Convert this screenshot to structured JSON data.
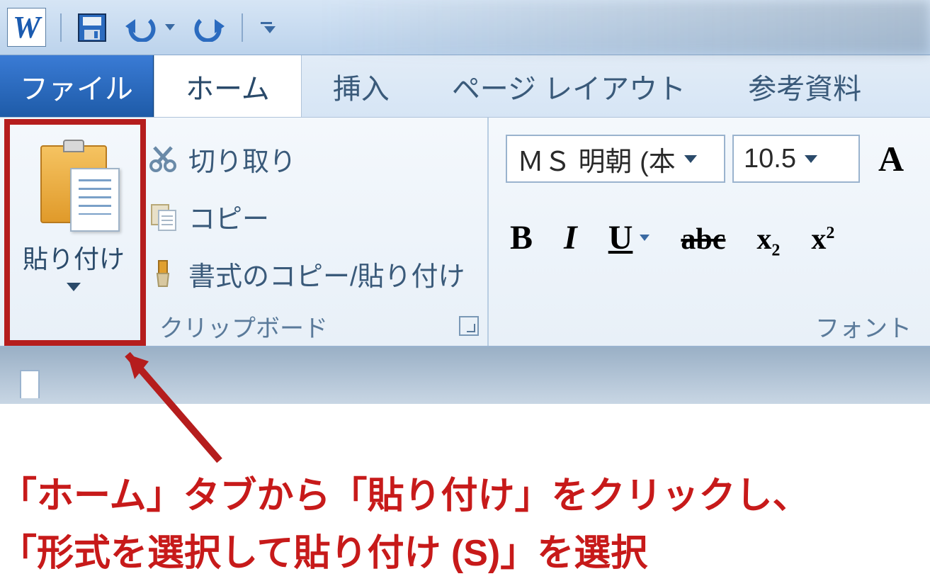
{
  "title_bar": {
    "app_letter": "W"
  },
  "tabs": {
    "file": "ファイル",
    "home": "ホーム",
    "insert": "挿入",
    "page_layout": "ページ レイアウト",
    "references": "参考資料"
  },
  "clipboard": {
    "paste": "貼り付け",
    "cut": "切り取り",
    "copy": "コピー",
    "format_painter": "書式のコピー/貼り付け",
    "group_label": "クリップボード"
  },
  "font": {
    "name_value": "ＭＳ 明朝 (本",
    "size_value": "10.5",
    "big_a": "A",
    "bold": "B",
    "italic": "I",
    "underline": "U",
    "strike": "abc",
    "subscript": "x",
    "subscript_sub": "2",
    "superscript": "x",
    "superscript_sup": "2",
    "group_label": "フォント"
  },
  "annotation": {
    "line1": "「ホーム」タブから「貼り付け」をクリックし、",
    "line2": "「形式を選択して貼り付け (S)」を選択"
  }
}
